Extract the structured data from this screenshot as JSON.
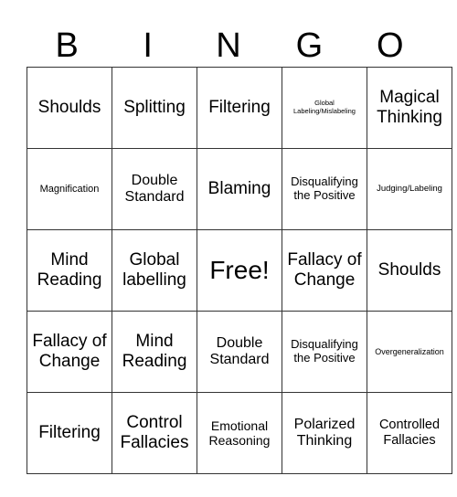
{
  "title_letters": [
    "B",
    "I",
    "N",
    "G",
    "O"
  ],
  "rows": [
    [
      "Shoulds",
      "Splitting",
      "Filtering",
      "Global Labeling/Mislabeling",
      "Magical Thinking"
    ],
    [
      "Magnification",
      "Double Standard",
      "Blaming",
      "Disqualifying the Positive",
      "Judging/Labeling"
    ],
    [
      "Mind Reading",
      "Global labelling",
      "Free!",
      "Fallacy of Change",
      "Shoulds"
    ],
    [
      "Fallacy of Change",
      "Mind Reading",
      "Double Standard",
      "Disqualifying the Positive",
      "Overgeneralization"
    ],
    [
      "Filtering",
      "Control Fallacies",
      "Emotional Reasoning",
      "Polarized Thinking",
      "Controlled Fallacies"
    ]
  ]
}
